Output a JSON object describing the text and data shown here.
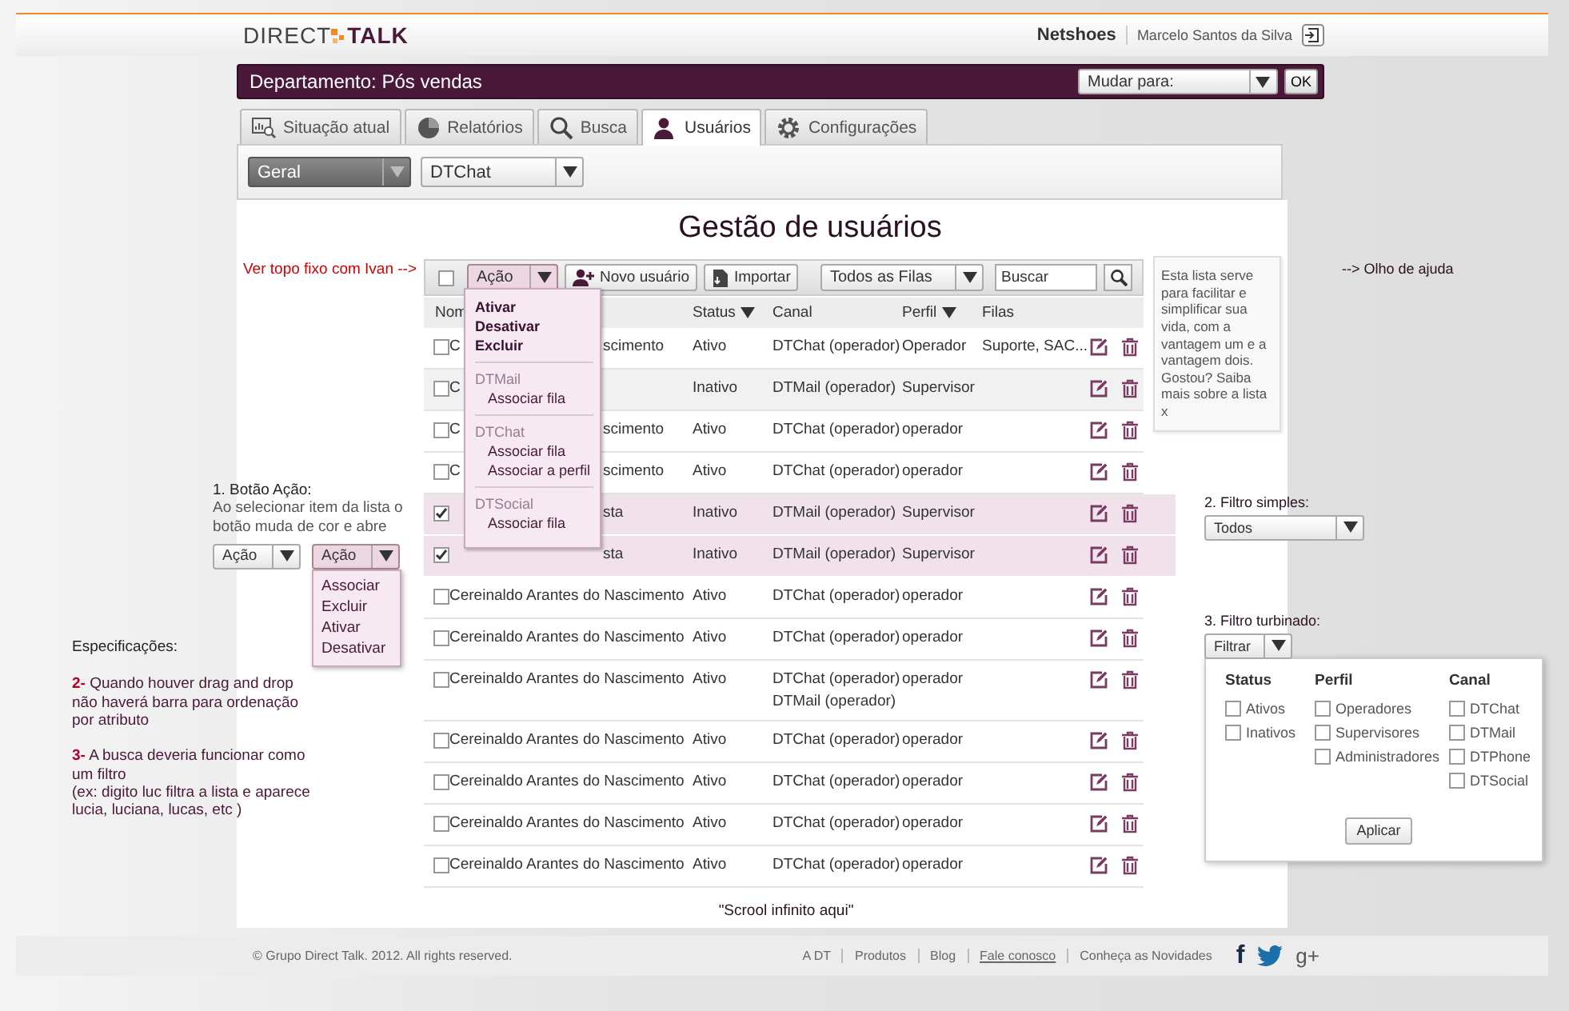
{
  "header": {
    "logo_left": "DIRECT",
    "logo_right": "TALK",
    "company": "Netshoes",
    "user": "Marcelo Santos da Silva"
  },
  "department_bar": {
    "title": "Departamento: Pós vendas",
    "switch_select": "Mudar para:",
    "ok_button": "OK"
  },
  "tabs": [
    {
      "label": "Situação atual",
      "selected": false
    },
    {
      "label": "Relatórios",
      "selected": false
    },
    {
      "label": "Busca",
      "selected": false
    },
    {
      "label": "Usuários",
      "selected": true
    },
    {
      "label": "Configurações",
      "selected": false
    }
  ],
  "sub_filters": [
    {
      "label": "Geral",
      "kind": "dark"
    },
    {
      "label": "DTChat",
      "kind": "light"
    }
  ],
  "users": {
    "title": "Gestão de usuários",
    "toolbar": {
      "select_all_checked": false,
      "action": "Ação",
      "action_active": true,
      "buttons": [
        "Novo usuário",
        "Importar"
      ],
      "queue_select": "Todos as Filas",
      "search_placeholder": "Buscar"
    },
    "columns": [
      {
        "label": "Nom"
      },
      {
        "label": "Status",
        "sortable": true
      },
      {
        "label": "Canal",
        "sortable": false
      },
      {
        "label": "Perfil",
        "sortable": true
      },
      {
        "label": "Filas",
        "sortable": false
      }
    ],
    "rows": [
      {
        "name": "C",
        "name_end": "scimento",
        "status": "Ativo",
        "channels": [
          "DTChat (operador)"
        ],
        "profile": "Operador",
        "queues": "Suporte, SAC...",
        "selected": false,
        "hovered": false
      },
      {
        "name": "C",
        "status": "Inativo",
        "channels": [
          "DTMail (operador)"
        ],
        "profile": "Supervisor",
        "selected": false,
        "hovered": true
      },
      {
        "name": "C",
        "name_end": "scimento",
        "status": "Ativo",
        "channels": [
          "DTChat (operador)"
        ],
        "profile": "operador",
        "selected": false,
        "hovered": false
      },
      {
        "name": "C",
        "name_end": "scimento",
        "status": "Ativo",
        "channels": [
          "DTChat (operador)"
        ],
        "profile": "operador",
        "selected": false,
        "hovered": false
      },
      {
        "name_end": "sta",
        "status": "Inativo",
        "channels": [
          "DTMail (operador)"
        ],
        "profile": "Supervisor",
        "selected": true,
        "hovered": false
      },
      {
        "name_end": "sta",
        "status": "Inativo",
        "channels": [
          "DTMail (operador)"
        ],
        "profile": "Supervisor",
        "selected": true,
        "hovered": false
      },
      {
        "name": "Cereinaldo Arantes do Nascimento",
        "status": "Ativo",
        "channels": [
          "DTChat (operador)"
        ],
        "profile": "operador",
        "selected": false,
        "hovered": false
      },
      {
        "name": "Cereinaldo Arantes do Nascimento",
        "status": "Ativo",
        "channels": [
          "DTChat (operador)"
        ],
        "profile": "operador",
        "selected": false,
        "hovered": false
      },
      {
        "name": "Cereinaldo Arantes do Nascimento",
        "status": "Ativo",
        "channels": [
          "DTChat (operador)",
          "DTMail (operador)"
        ],
        "profile": "operador",
        "selected": false,
        "hovered": false
      },
      {
        "name": "Cereinaldo Arantes do Nascimento",
        "status": "Ativo",
        "channels": [
          "DTChat (operador)"
        ],
        "profile": "operador",
        "selected": false,
        "hovered": false
      },
      {
        "name": "Cereinaldo Arantes do Nascimento",
        "status": "Ativo",
        "channels": [
          "DTChat (operador)"
        ],
        "profile": "operador",
        "selected": false,
        "hovered": false
      },
      {
        "name": "Cereinaldo Arantes do Nascimento",
        "status": "Ativo",
        "channels": [
          "DTChat (operador)"
        ],
        "profile": "operador",
        "selected": false,
        "hovered": false
      },
      {
        "name": "Cereinaldo Arantes do Nascimento",
        "status": "Ativo",
        "channels": [
          "DTChat (operador)"
        ],
        "profile": "operador",
        "selected": false,
        "hovered": false
      }
    ],
    "action_menu": [
      {
        "kind": "action",
        "label": "Ativar"
      },
      {
        "kind": "action",
        "label": "Desativar"
      },
      {
        "kind": "action",
        "label": "Excluir"
      },
      {
        "kind": "group",
        "label": "DTMail"
      },
      {
        "kind": "sub",
        "label": "Associar fila"
      },
      {
        "kind": "group",
        "label": "DTChat"
      },
      {
        "kind": "sub",
        "label": "Associar fila"
      },
      {
        "kind": "sub",
        "label": "Associar a perfil"
      },
      {
        "kind": "group",
        "label": "DTSocial"
      },
      {
        "kind": "sub",
        "label": "Associar fila"
      }
    ],
    "footnote": "\"Scrool infinito aqui\""
  },
  "left_notes": {
    "top_note": "Ver topo fixo com Ivan -->",
    "action_note": {
      "title": "1. Botão Ação:",
      "text": "Ao selecionar item da lista o botão muda de cor e abre",
      "idle_button": "Ação",
      "active_button": "Ação",
      "menu": [
        "Associar",
        "Excluir",
        "Ativar",
        "Desativar"
      ]
    },
    "specs": {
      "title": "Especificações:",
      "items": [
        "**2-** Quando houver drag and drop não haverá barra para ordenação por atributo",
        "**3-** A busca deveria funcionar como um filtro\n(ex: digito luc filtra a lista e aparece lucia, luciana, lucas, etc )"
      ]
    }
  },
  "right_panel": {
    "help_text": "Esta lista serve para facilitar e simplificar sua vida, com a vantagem um e a vantagem dois. Gostou? Saiba mais sobre a lista x",
    "help_note": "--> Olho de ajuda",
    "simple_filter": {
      "title": "2. Filtro simples:",
      "value": "Todos"
    },
    "turbo_filter": {
      "title": "3. Filtro turbinado:",
      "button": "Filtrar",
      "apply": "Aplicar",
      "groups": [
        {
          "title": "Status",
          "options": [
            {
              "label": "Ativos",
              "checked": false
            },
            {
              "label": "Inativos",
              "checked": false
            }
          ]
        },
        {
          "title": "Perfil",
          "options": [
            {
              "label": "Operadores",
              "checked": false
            },
            {
              "label": "Supervisores",
              "checked": false
            },
            {
              "label": "Administradores",
              "checked": false
            }
          ]
        },
        {
          "title": "Canal",
          "options": [
            {
              "label": "DTChat",
              "checked": false
            },
            {
              "label": "DTMail",
              "checked": false
            },
            {
              "label": "DTPhone",
              "checked": false
            },
            {
              "label": "DTSocial",
              "checked": false
            }
          ]
        }
      ]
    }
  },
  "footer": {
    "copyright": "© Grupo Direct Talk. 2012. All rights reserved.",
    "links": [
      {
        "label": "A DT",
        "underlined": false
      },
      {
        "label": "Produtos",
        "underlined": false
      },
      {
        "label": "Blog",
        "underlined": false
      },
      {
        "label": "Fale conosco",
        "underlined": true
      },
      {
        "label": "Conheça as Novidades",
        "underlined": false
      }
    ],
    "social": [
      {
        "kind": "text",
        "label": "f"
      },
      {
        "kind": "bird"
      },
      {
        "kind": "text",
        "label": "g+"
      }
    ]
  }
}
